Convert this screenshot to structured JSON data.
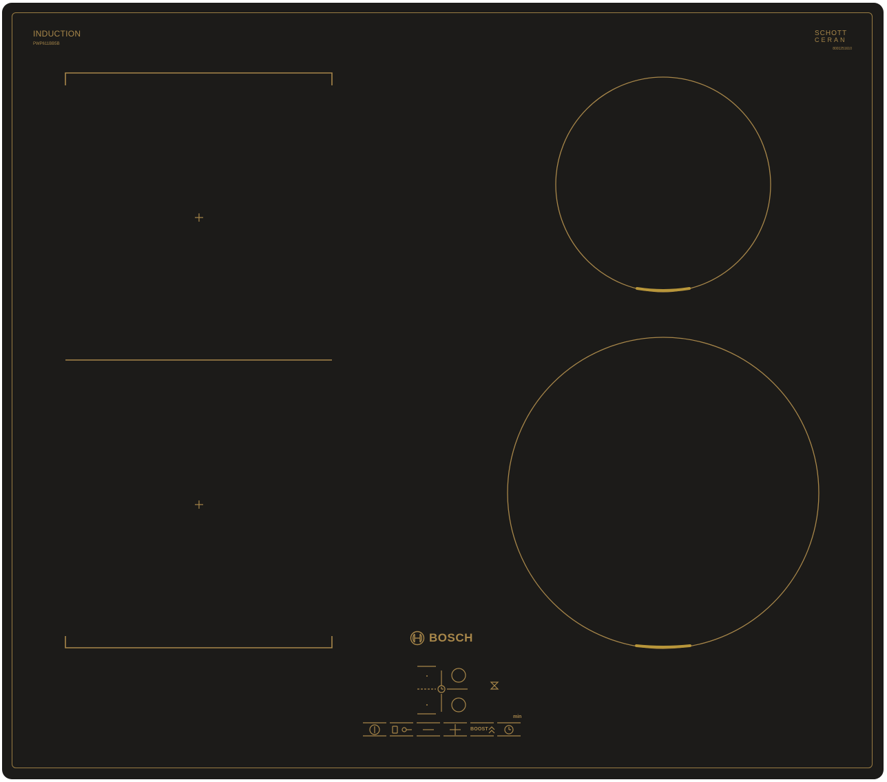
{
  "product": {
    "type_label": "INDUCTION",
    "model": "PWP611BB5B",
    "glass_brand": {
      "line1": "SCHOTT",
      "line2": "CERAN",
      "code": "8001251610"
    },
    "brand": "BOSCH"
  },
  "controls": {
    "boost_label": "BOOST",
    "min_label": "min",
    "buttons": [
      "power",
      "child-lock",
      "minus",
      "plus",
      "boost",
      "timer"
    ],
    "indicators": [
      "zone-select-top",
      "zone-select-bottom",
      "timer-zone",
      "egg-timer"
    ]
  },
  "colors": {
    "glass": "#1c1b19",
    "print": "#a8874a",
    "zone_marker": "#b8963a"
  },
  "cooking_zones": [
    {
      "name": "flex-zone-front-left",
      "shape": "rectangle"
    },
    {
      "name": "flex-zone-rear-left",
      "shape": "rectangle"
    },
    {
      "name": "rear-right-zone",
      "shape": "circle"
    },
    {
      "name": "front-right-zone",
      "shape": "circle"
    }
  ]
}
